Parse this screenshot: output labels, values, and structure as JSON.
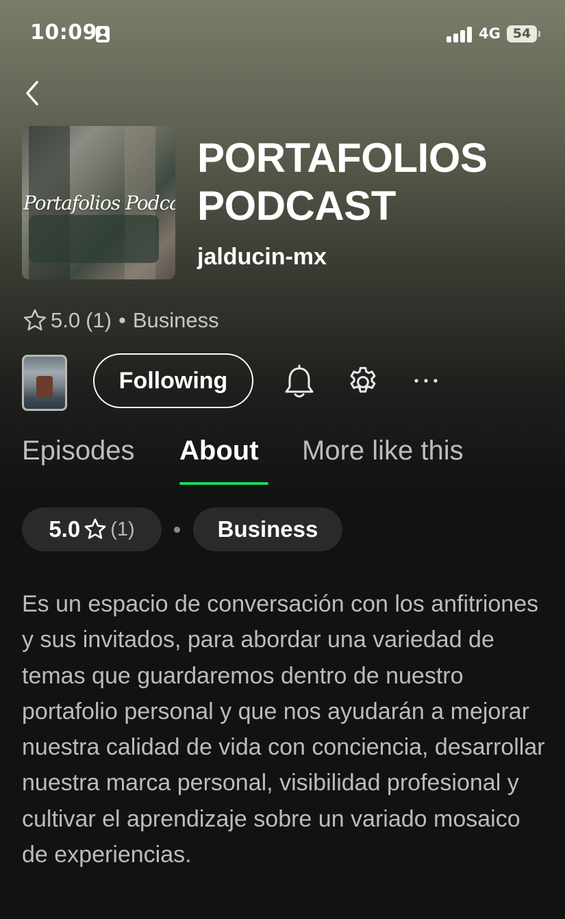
{
  "status_bar": {
    "time": "10:09",
    "network": "4G",
    "battery": "54"
  },
  "podcast": {
    "cover_text": "Portafolios Podcast",
    "title": "PORTAFOLIOS PODCAST",
    "author": "jalducin-mx",
    "rating": "5.0",
    "rating_count": "(1)",
    "separator": "•",
    "category": "Business"
  },
  "actions": {
    "follow_label": "Following",
    "more_label": "···"
  },
  "tabs": [
    {
      "label": "Episodes",
      "active": false
    },
    {
      "label": "About",
      "active": true
    },
    {
      "label": "More like this",
      "active": false
    }
  ],
  "about": {
    "rating": "5.0",
    "rating_count": "(1)",
    "category": "Business",
    "description": "Es un espacio de conversación con los anfitriones y sus invitados, para abordar una variedad de temas que guardaremos dentro de nuestro portafolio personal y que nos ayudarán a mejorar nuestra calidad de vida con conciencia, desarrollar nuestra marca personal, visibilidad profesional y cultivar el aprendizaje sobre un variado mosaico de experiencias."
  },
  "colors": {
    "accent_underline": "#1ed760",
    "chip_background": "#2a2a2a",
    "page_background": "#121212"
  },
  "icons": [
    "user-badge-icon",
    "signal-icon",
    "battery-icon",
    "back-chevron-icon",
    "star-icon",
    "bell-icon",
    "gear-icon",
    "more-dots-icon"
  ]
}
